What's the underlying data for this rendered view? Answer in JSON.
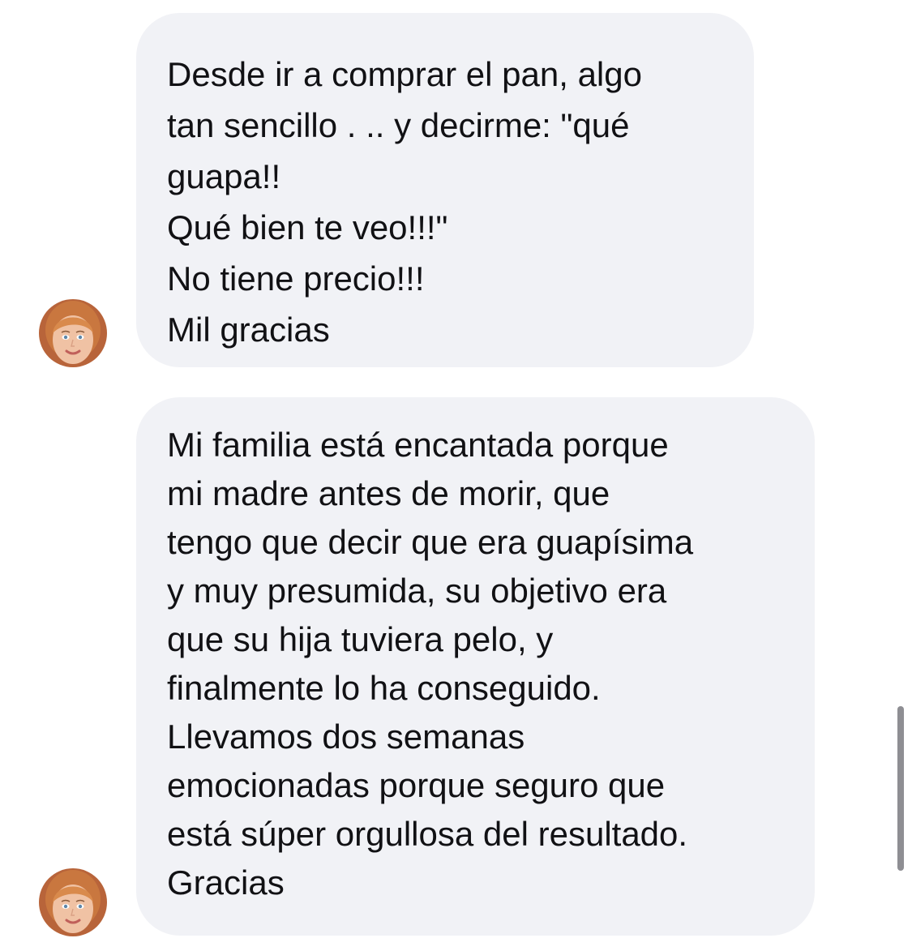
{
  "conversation": {
    "messages": [
      {
        "lines": [
          "Desde ir a comprar el pan, algo",
          "tan sencillo . .. y decirme: \"qué",
          "guapa!!",
          "Qué bien te veo!!!\"",
          "No tiene precio!!!",
          "Mil gracias"
        ]
      },
      {
        "lines": [
          "Mi familia está encantada porque",
          "mi madre antes de morir, que",
          "tengo que decir que era guapísima",
          "y muy presumida, su objetivo era",
          "que su hija tuviera pelo, y",
          "finalmente lo ha conseguido.",
          "Llevamos dos  semanas",
          "emocionadas porque seguro que",
          "está súper orgullosa del resultado.",
          "Gracias"
        ]
      }
    ]
  },
  "colors": {
    "bubble_background": "#f1f2f6",
    "text": "#111114",
    "scrollbar": "#8e8e93"
  }
}
